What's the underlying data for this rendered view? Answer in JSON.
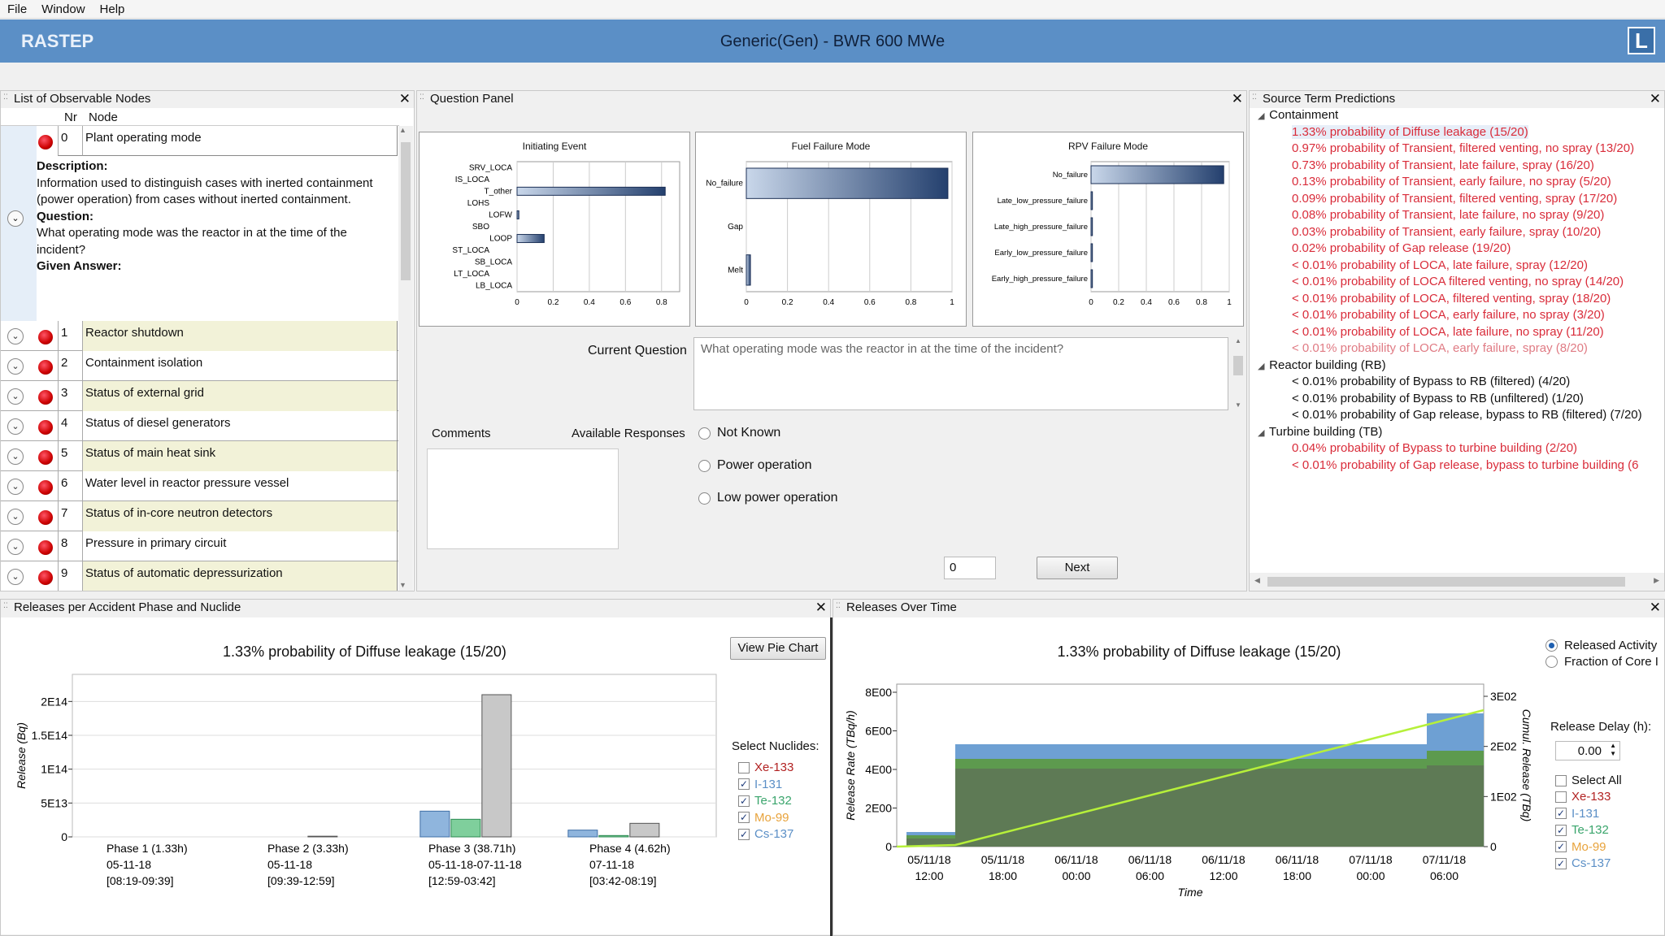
{
  "menu": [
    "File",
    "Window",
    "Help"
  ],
  "app": {
    "name": "RASTEP",
    "subtitle": "Generic(Gen) - BWR 600 MWe",
    "logo": "L"
  },
  "observable_nodes": {
    "title": "List of Observable Nodes",
    "col_nr": "Nr",
    "col_node": "Node",
    "selected": {
      "nr": "0",
      "name": "Plant operating mode",
      "desc_label": "Description:",
      "desc": "Information used to distinguish cases with inerted containment (power operation) from cases without inerted containment.",
      "q_label": "Question:",
      "q": "What operating mode was the reactor in at the time of the incident?",
      "ans_label": "Given Answer:"
    },
    "rows": [
      {
        "nr": "1",
        "name": "Reactor shutdown"
      },
      {
        "nr": "2",
        "name": "Containment isolation"
      },
      {
        "nr": "3",
        "name": "Status of external grid"
      },
      {
        "nr": "4",
        "name": "Status of diesel generators"
      },
      {
        "nr": "5",
        "name": "Status of main heat sink"
      },
      {
        "nr": "6",
        "name": "Water level in reactor pressure vessel"
      },
      {
        "nr": "7",
        "name": "Status of in-core neutron detectors"
      },
      {
        "nr": "8",
        "name": "Pressure in primary circuit"
      },
      {
        "nr": "9",
        "name": "Status of automatic depressurization"
      }
    ]
  },
  "question_panel": {
    "title": "Question Panel",
    "current_question_label": "Current Question",
    "current_question": "What operating mode was the reactor in at the time of the incident?",
    "comments_label": "Comments",
    "responses_label": "Available Responses",
    "responses": [
      "Not Known",
      "Power operation",
      "Low power operation"
    ],
    "input_value": "0",
    "next_label": "Next"
  },
  "source_term": {
    "title": "Source Term Predictions",
    "groups": [
      {
        "name": "Containment",
        "items": [
          {
            "t": "1.33% probability of Diffuse leakage (15/20)",
            "c": "red"
          },
          {
            "t": "0.97% probability of Transient, filtered venting, no spray (13/20)",
            "c": "red"
          },
          {
            "t": "0.73% probability of Transient, late failure, spray (16/20)",
            "c": "red"
          },
          {
            "t": "0.13% probability of Transient, early failure, no spray (5/20)",
            "c": "red"
          },
          {
            "t": "0.09% probability of Transient, filtered venting, spray (17/20)",
            "c": "red"
          },
          {
            "t": "0.08% probability of Transient, late failure, no spray (9/20)",
            "c": "red"
          },
          {
            "t": "0.03% probability of Transient, early failure, spray (10/20)",
            "c": "red"
          },
          {
            "t": "0.02% probability of Gap release (19/20)",
            "c": "red"
          },
          {
            "t": "< 0.01% probability of LOCA, late failure, spray (12/20)",
            "c": "red"
          },
          {
            "t": "< 0.01% probability of LOCA filtered venting, no spray (14/20)",
            "c": "red"
          },
          {
            "t": "< 0.01% probability of LOCA, filtered venting, spray (18/20)",
            "c": "red"
          },
          {
            "t": "< 0.01% probability of LOCA, early failure, no spray (3/20)",
            "c": "red"
          },
          {
            "t": "< 0.01% probability of LOCA, late failure, no spray (11/20)",
            "c": "red"
          },
          {
            "t": "< 0.01% probability of LOCA, early failure, spray (8/20)",
            "c": "pink"
          }
        ]
      },
      {
        "name": "Reactor building (RB)",
        "items": [
          {
            "t": "< 0.01% probability of Bypass to RB (filtered) (4/20)",
            "c": "blk"
          },
          {
            "t": "< 0.01% probability of Bypass to RB (unfiltered) (1/20)",
            "c": "blk"
          },
          {
            "t": "< 0.01% probability of Gap release, bypass to RB (filtered) (7/20)",
            "c": "blk"
          }
        ]
      },
      {
        "name": "Turbine building (TB)",
        "items": [
          {
            "t": "0.04% probability of Bypass to turbine building (2/20)",
            "c": "red"
          },
          {
            "t": "< 0.01% probability of Gap release, bypass to turbine building (6",
            "c": "red"
          }
        ]
      }
    ]
  },
  "releases_phase": {
    "title": "Releases per Accident Phase and Nuclide",
    "view_pie_label": "View Pie Chart",
    "select_label": "Select Nuclides:",
    "nuclides": [
      {
        "name": "Xe-133",
        "checked": false,
        "color": "#b22222"
      },
      {
        "name": "I-131",
        "checked": true,
        "color": "#5b8fc6"
      },
      {
        "name": "Te-132",
        "checked": true,
        "color": "#3aa56c"
      },
      {
        "name": "Mo-99",
        "checked": true,
        "color": "#e8a33c"
      },
      {
        "name": "Cs-137",
        "checked": true,
        "color": "#5b8fc6"
      }
    ],
    "check_mark": "✓"
  },
  "releases_time": {
    "title": "Releases Over Time",
    "radio": [
      "Released Activity",
      "Fraction of Core I"
    ],
    "delay_label": "Release Delay (h):",
    "delay_value": "0.00",
    "select_all": "Select All",
    "nuclides": [
      {
        "name": "Xe-133",
        "checked": false,
        "color": "#b22222"
      },
      {
        "name": "I-131",
        "checked": true,
        "color": "#5b8fc6"
      },
      {
        "name": "Te-132",
        "checked": true,
        "color": "#3aa56c"
      },
      {
        "name": "Mo-99",
        "checked": true,
        "color": "#e8a33c"
      },
      {
        "name": "Cs-137",
        "checked": true,
        "color": "#5b8fc6"
      }
    ]
  },
  "chart_data": [
    {
      "type": "bar",
      "title": "Initiating Event",
      "categories": [
        "SRV_LOCA",
        "IS_LOCA",
        "T_other",
        "LOHS",
        "LOFW",
        "SBO",
        "LOOP",
        "ST_LOCA",
        "SB_LOCA",
        "LT_LOCA",
        "LB_LOCA"
      ],
      "values": [
        0,
        0,
        0.82,
        0,
        0.01,
        0,
        0.15,
        0,
        0,
        0,
        0
      ],
      "xlim": [
        0,
        0.9
      ],
      "xticks": [
        0,
        0.2,
        0.4,
        0.6,
        0.8
      ]
    },
    {
      "type": "bar",
      "title": "Fuel Failure Mode",
      "categories": [
        "No_failure",
        "Gap",
        "Melt"
      ],
      "values": [
        0.98,
        0,
        0.02
      ],
      "xlim": [
        0,
        1
      ],
      "xticks": [
        0,
        0.2,
        0.4,
        0.6,
        0.8,
        1
      ]
    },
    {
      "type": "bar",
      "title": "RPV Failure Mode",
      "categories": [
        "No_failure",
        "Late_low_pressure_failure",
        "Late_high_pressure_failure",
        "Early_low_pressure_failure",
        "Early_high_pressure_failure"
      ],
      "values": [
        0.96,
        0.01,
        0.01,
        0.01,
        0.01
      ],
      "xlim": [
        0,
        1
      ],
      "xticks": [
        0,
        0.2,
        0.4,
        0.6,
        0.8,
        1
      ]
    },
    {
      "type": "bar",
      "title": "1.33% probability of Diffuse leakage (15/20)",
      "ylabel": "Release (Bq)",
      "ylim": [
        0,
        240000000000000.0
      ],
      "yticks": [
        "0",
        "5E13",
        "1E14",
        "1.5E14",
        "2E14"
      ],
      "ytick_values": [
        0,
        50000000000000.0,
        100000000000000.0,
        150000000000000.0,
        200000000000000.0
      ],
      "categories": [
        "Phase 1  (1.33h)",
        "Phase 2  (3.33h)",
        "Phase 3  (38.71h)",
        "Phase 4  (4.62h)"
      ],
      "cat_line2": [
        "05-11-18",
        "05-11-18",
        "05-11-18-07-11-18",
        "07-11-18"
      ],
      "cat_line3": [
        "[08:19-09:39]",
        "[09:39-12:59]",
        "[12:59-03:42]",
        "[03:42-08:19]"
      ],
      "series": [
        {
          "name": "I-131",
          "values": [
            0,
            0,
            38000000000000.0,
            10000000000000.0
          ]
        },
        {
          "name": "Te-132",
          "values": [
            0,
            0,
            26000000000000.0,
            2000000000000.0
          ]
        },
        {
          "name": "Cs-137",
          "values": [
            0,
            1000000000000.0,
            210000000000000.0,
            20000000000000.0
          ]
        }
      ]
    },
    {
      "type": "area",
      "title": "1.33% probability of Diffuse leakage (15/20)",
      "xlabel": "Time",
      "ylabel": "Release Rate (TBq/h)",
      "y2label": "Cumul. Release (TBq)",
      "yticks": [
        "0",
        "2E00",
        "4E00",
        "6E00",
        "8E00"
      ],
      "y2ticks": [
        "0",
        "1E02",
        "2E02",
        "3E02"
      ],
      "xticks": [
        [
          "05/11/18",
          "12:00"
        ],
        [
          "05/11/18",
          "18:00"
        ],
        [
          "06/11/18",
          "00:00"
        ],
        [
          "06/11/18",
          "06:00"
        ],
        [
          "06/11/18",
          "12:00"
        ],
        [
          "06/11/18",
          "18:00"
        ],
        [
          "07/11/18",
          "00:00"
        ],
        [
          "07/11/18",
          "06:00"
        ]
      ]
    }
  ]
}
